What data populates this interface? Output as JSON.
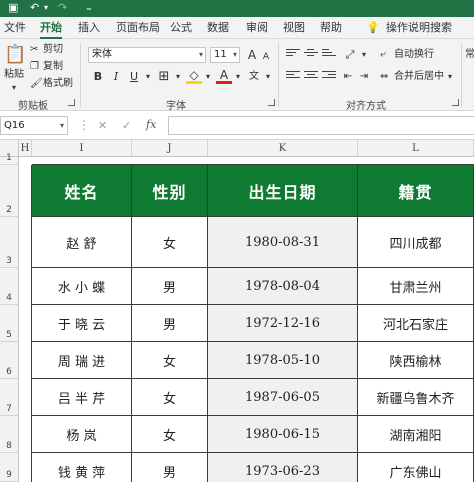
{
  "quick_access": {
    "save": "▣",
    "undo": "↶",
    "redo": "↷",
    "customize": "₌"
  },
  "menu": {
    "tabs": [
      "文件",
      "开始",
      "插入",
      "页面布局",
      "公式",
      "数据",
      "审阅",
      "视图",
      "帮助"
    ],
    "active": "开始",
    "tell_me": "操作说明搜索",
    "tell_me_icon": "lightbulb-icon"
  },
  "ribbon": {
    "clipboard": {
      "paste": "粘贴",
      "cut": "剪切",
      "copy": "复制",
      "format_painter": "格式刷",
      "label": "剪贴板"
    },
    "font": {
      "name": "宋体",
      "size": "11",
      "bold": "B",
      "italic": "I",
      "underline": "U",
      "grow": "A",
      "shrink": "A",
      "label": "字体"
    },
    "alignment": {
      "wrap_text": "自动换行",
      "merge_center": "合并后居中",
      "label": "对齐方式"
    },
    "number": {
      "format": "常"
    }
  },
  "formula_bar": {
    "name_box": "Q16",
    "cancel": "✕",
    "enter": "✓",
    "fx": "fx",
    "value": ""
  },
  "grid": {
    "columns": [
      "H",
      "I",
      "J",
      "K",
      "L"
    ],
    "rows": [
      "1",
      "2",
      "3",
      "4",
      "5",
      "6",
      "7",
      "8",
      "9"
    ],
    "headers": [
      "姓名",
      "性别",
      "出生日期",
      "籍贯"
    ],
    "records": [
      [
        "赵    舒",
        "女",
        "1980-08-31",
        "四川成都"
      ],
      [
        "水 小 蝶",
        "男",
        "1978-08-04",
        "甘肃兰州"
      ],
      [
        "于 晓 云",
        "男",
        "1972-12-16",
        "河北石家庄"
      ],
      [
        "周 瑞 进",
        "女",
        "1978-05-10",
        "陕西榆林"
      ],
      [
        "吕 半 芹",
        "女",
        "1987-06-05",
        "新疆乌鲁木齐"
      ],
      [
        "杨    岚",
        "女",
        "1980-06-15",
        "湖南湘阳"
      ],
      [
        "钱 黄 萍",
        "男",
        "1973-06-23",
        "广东佛山"
      ]
    ],
    "header_color": "#0e7a32"
  }
}
